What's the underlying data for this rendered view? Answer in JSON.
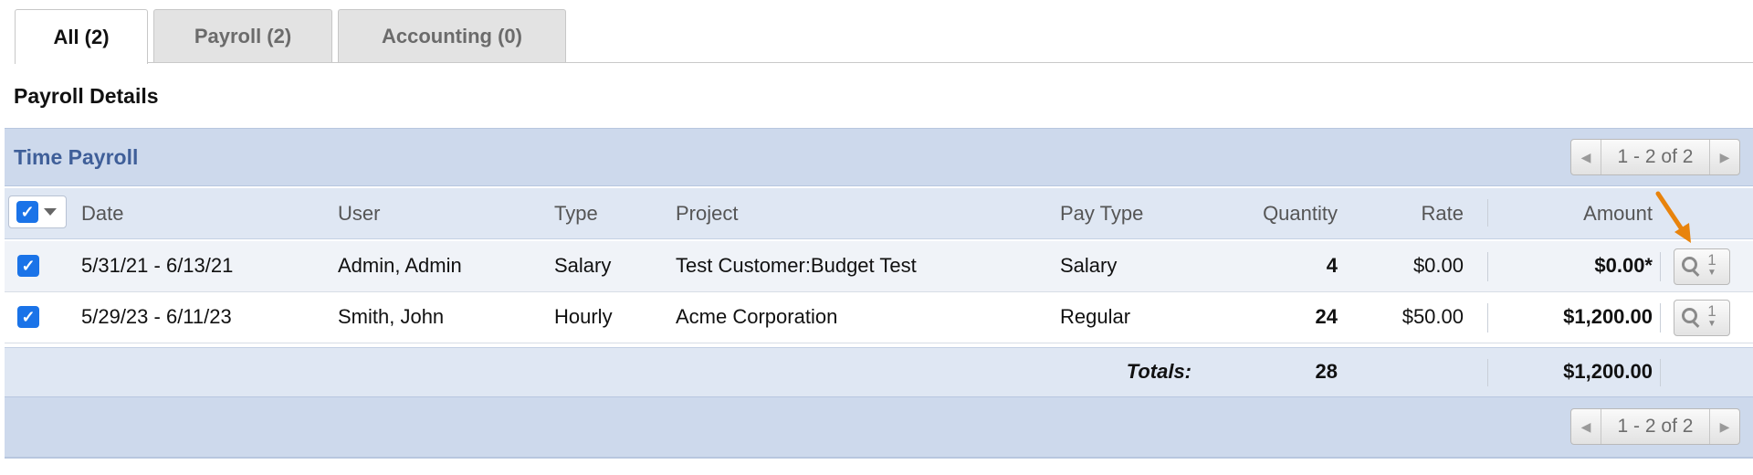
{
  "tabs": [
    {
      "label": "All (2)",
      "active": true
    },
    {
      "label": "Payroll (2)",
      "active": false
    },
    {
      "label": "Accounting (0)",
      "active": false
    }
  ],
  "section_title": "Payroll Details",
  "panel": {
    "title": "Time Payroll",
    "pager_label": "1 - 2 of 2"
  },
  "columns": {
    "date": "Date",
    "user": "User",
    "type": "Type",
    "project": "Project",
    "pay_type": "Pay Type",
    "quantity": "Quantity",
    "rate": "Rate",
    "amount": "Amount"
  },
  "rows": [
    {
      "checked": true,
      "date": "5/31/21 - 6/13/21",
      "user": "Admin, Admin",
      "type": "Salary",
      "project": "Test Customer:Budget Test",
      "pay_type": "Salary",
      "quantity": "4",
      "rate": "$0.00",
      "amount": "$0.00*",
      "detail_count": "1"
    },
    {
      "checked": true,
      "date": "5/29/23 - 6/11/23",
      "user": "Smith, John",
      "type": "Hourly",
      "project": "Acme Corporation",
      "pay_type": "Regular",
      "quantity": "24",
      "rate": "$50.00",
      "amount": "$1,200.00",
      "detail_count": "1"
    }
  ],
  "totals": {
    "label": "Totals:",
    "quantity": "28",
    "amount": "$1,200.00"
  },
  "footer": {
    "pager_label": "1 - 2 of 2"
  },
  "colors": {
    "header_blue": "#cdd9ec",
    "title_blue": "#3f5f99",
    "checkbox_blue": "#1a73e8",
    "annotation_orange": "#e8830c"
  },
  "icons": {
    "checkbox": "checkmark-icon",
    "dropdown": "caret-down-icon",
    "pager_prev": "chevron-left-icon",
    "pager_next": "chevron-right-icon",
    "detail": "magnifier-icon",
    "annotation": "arrow-icon"
  }
}
